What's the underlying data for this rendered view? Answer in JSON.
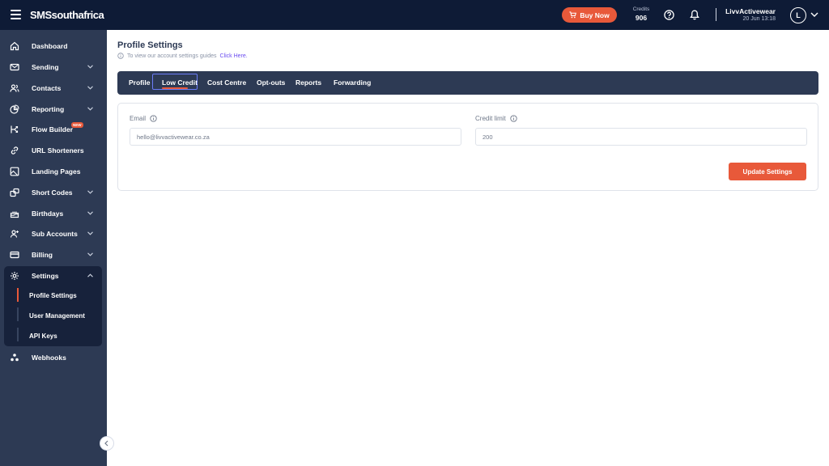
{
  "header": {
    "logo": "SMSsouthafrica",
    "buy_now": "Buy Now",
    "credits_label": "Credits",
    "credits_value": "906",
    "user_name": "LivvActivewear",
    "user_date": "20 Jun 13:18",
    "avatar_letter": "L",
    "accent_color": "#e8593a"
  },
  "sidebar": {
    "items": [
      {
        "label": "Dashboard",
        "icon": "home-icon"
      },
      {
        "label": "Sending",
        "icon": "mail-icon"
      },
      {
        "label": "Contacts",
        "icon": "contacts-icon"
      },
      {
        "label": "Reporting",
        "icon": "chart-pie-icon"
      },
      {
        "label": "Flow Builder",
        "icon": "flow-icon",
        "badge": "NEW"
      },
      {
        "label": "URL Shorteners",
        "icon": "link-icon"
      },
      {
        "label": "Landing Pages",
        "icon": "image-icon"
      },
      {
        "label": "Short Codes",
        "icon": "short-code-icon"
      },
      {
        "label": "Birthdays",
        "icon": "cake-icon"
      },
      {
        "label": "Sub Accounts",
        "icon": "user-plus-icon"
      },
      {
        "label": "Billing",
        "icon": "credit-card-icon"
      },
      {
        "label": "Settings",
        "icon": "gear-icon"
      },
      {
        "label": "Webhooks",
        "icon": "webhook-icon"
      }
    ],
    "settings_sub": [
      "Profile Settings",
      "User Management",
      "API Keys"
    ]
  },
  "main": {
    "title": "Profile Settings",
    "info_text": "To view our account settings guides",
    "info_link": "Click Here.",
    "tabs": [
      "Profile",
      "Low Credit",
      "Cost Centre",
      "Opt-outs",
      "Reports",
      "Forwarding"
    ],
    "active_tab": "Low Credit",
    "form": {
      "email_label": "Email",
      "email_value": "hello@livvactivewear.co.za",
      "credit_label": "Credit limit",
      "credit_value": "200",
      "update_button": "Update Settings"
    }
  }
}
